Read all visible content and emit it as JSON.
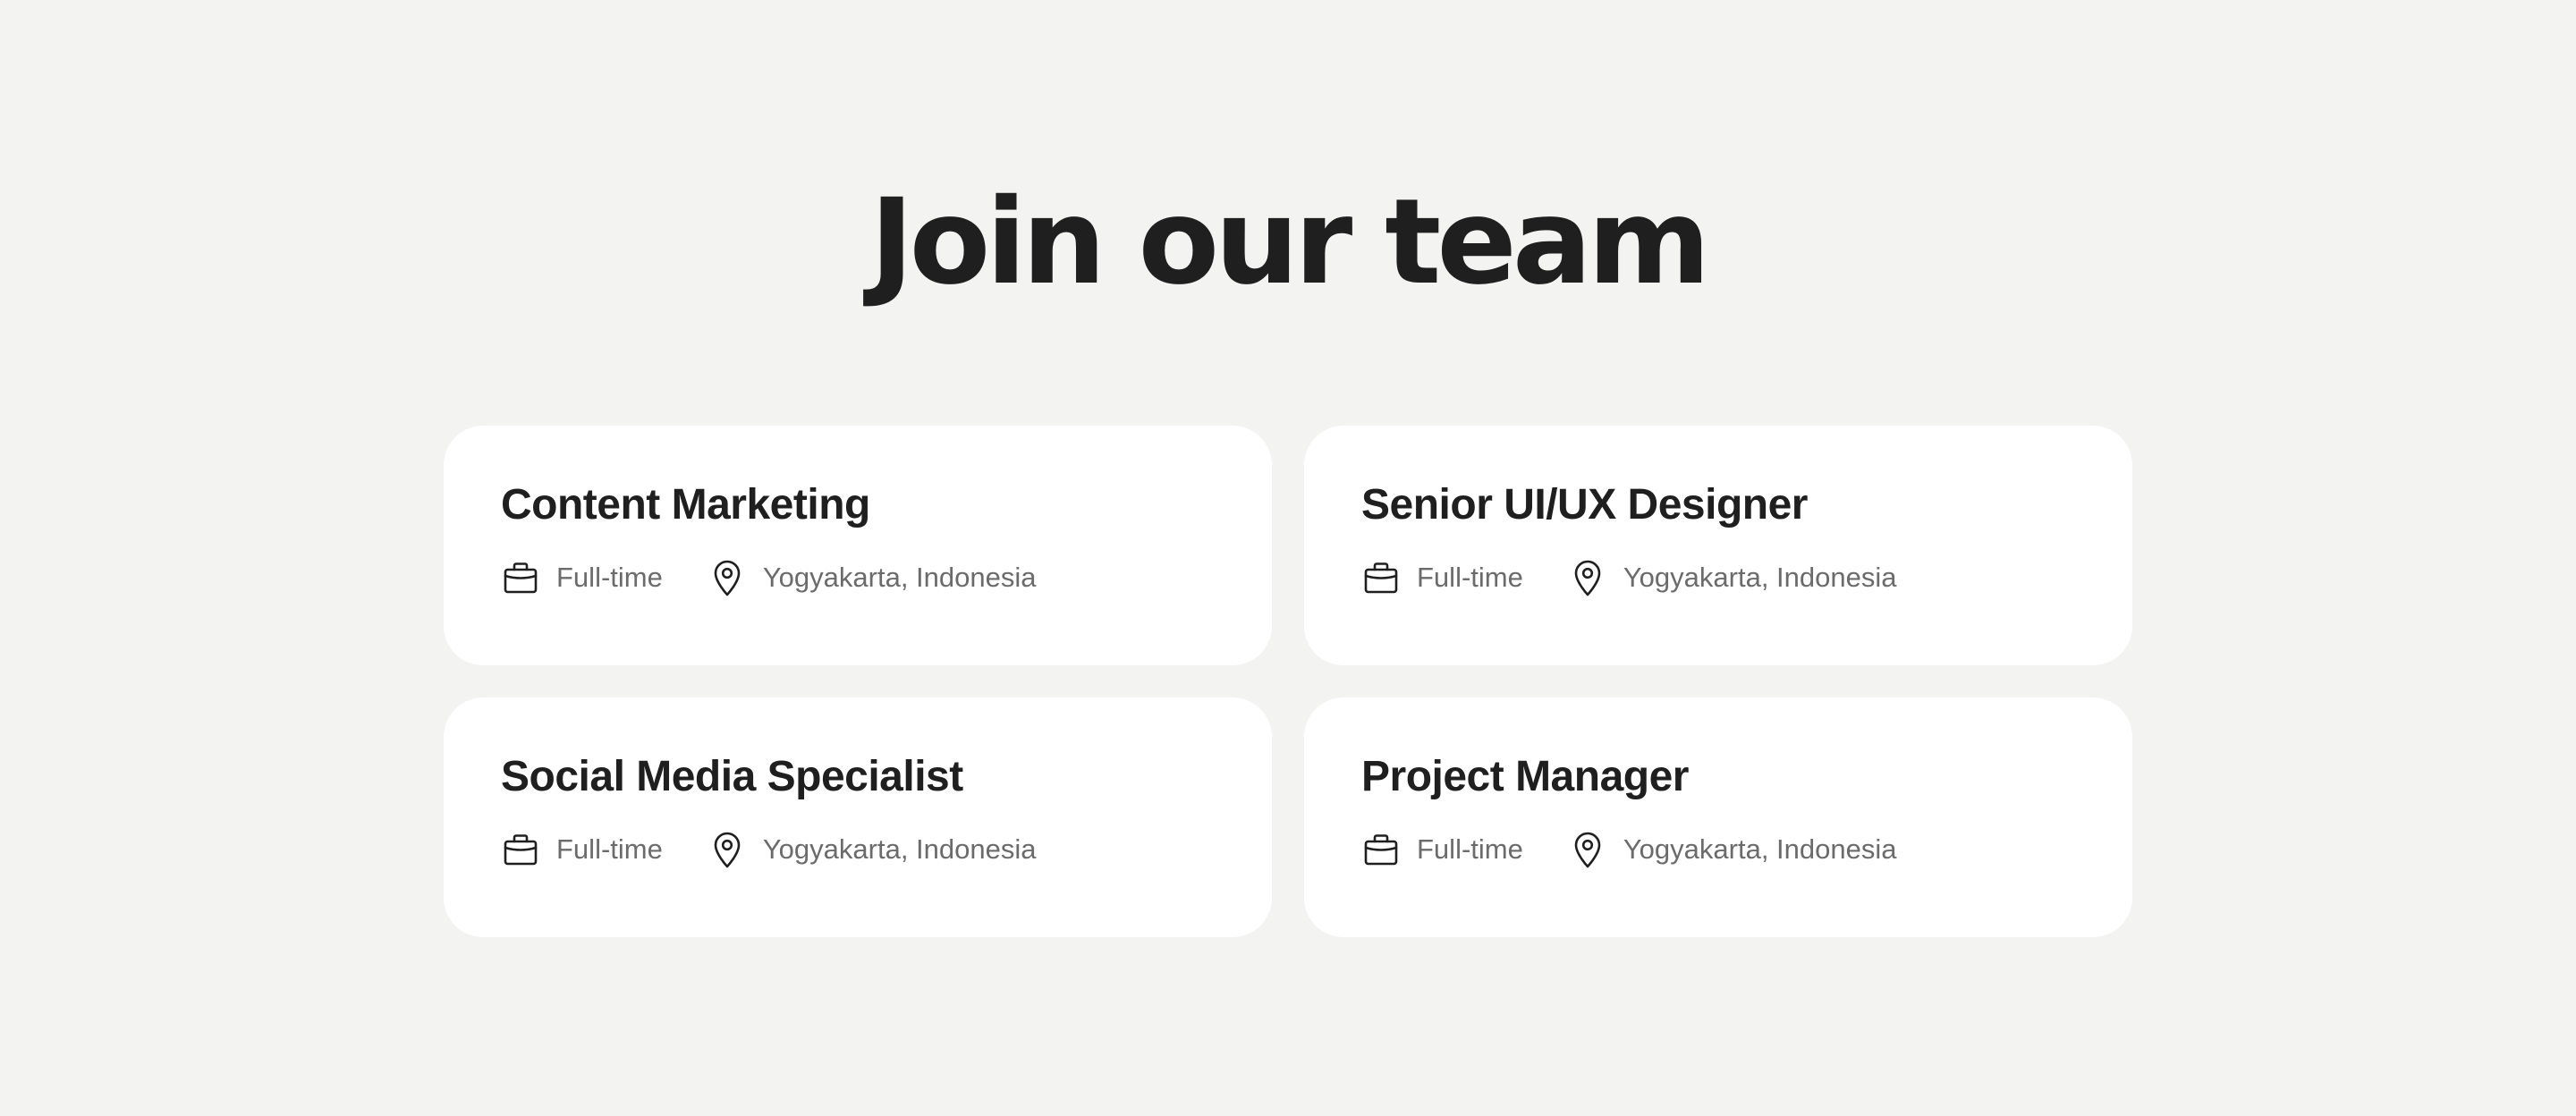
{
  "header": {
    "title": "Join our team"
  },
  "jobs": [
    {
      "title": "Content Marketing",
      "type": "Full-time",
      "location": "Yogyakarta, Indonesia",
      "type_icon": "briefcase-icon",
      "location_icon": "map-pin-icon"
    },
    {
      "title": "Senior UI/UX Designer",
      "type": "Full-time",
      "location": "Yogyakarta, Indonesia",
      "type_icon": "briefcase-icon",
      "location_icon": "map-pin-icon"
    },
    {
      "title": "Social Media Specialist",
      "type": "Full-time",
      "location": "Yogyakarta, Indonesia",
      "type_icon": "briefcase-icon",
      "location_icon": "map-pin-icon"
    },
    {
      "title": "Project Manager",
      "type": "Full-time",
      "location": "Yogyakarta, Indonesia",
      "type_icon": "briefcase-icon",
      "location_icon": "map-pin-icon"
    }
  ],
  "colors": {
    "background": "#f3f3f2",
    "card": "#ffffff",
    "heading": "#1f1f1f",
    "meta_text": "#6b6b6b"
  }
}
